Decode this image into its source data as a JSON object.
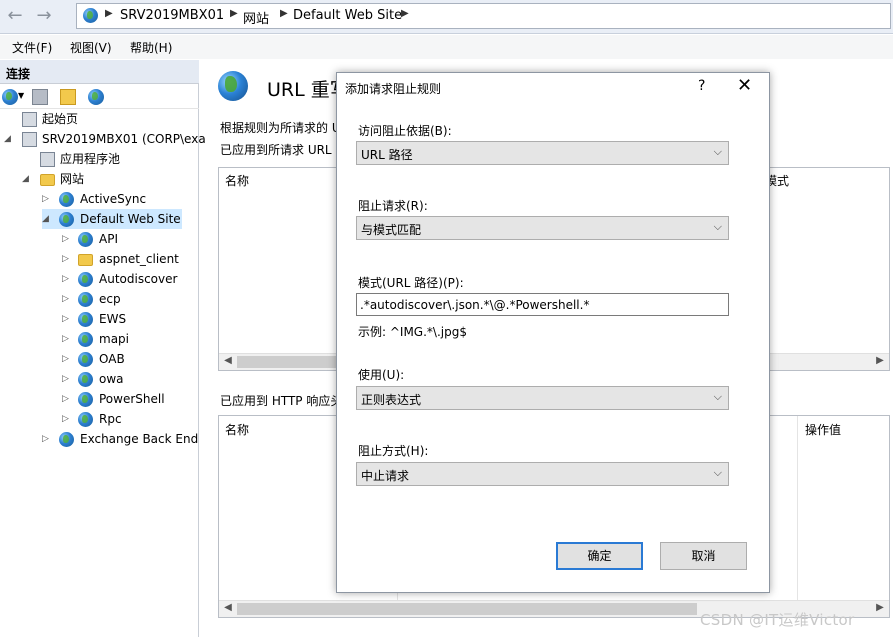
{
  "address_bar": {
    "crumbs": [
      "SRV2019MBX01",
      "网站",
      "Default Web Site"
    ]
  },
  "menu": {
    "items": [
      "文件(F)",
      "视图(V)",
      "帮助(H)"
    ]
  },
  "connections": {
    "title": "连接",
    "toolbar_icons": [
      "connect-icon",
      "save-icon",
      "up-folder-icon",
      "disconnect-icon"
    ],
    "tree": [
      {
        "label": "起始页",
        "icon": "start-page-icon"
      },
      {
        "label": "SRV2019MBX01 (CORP\\exa",
        "icon": "server-icon"
      },
      {
        "label": "应用程序池",
        "icon": "app-pool-icon"
      },
      {
        "label": "网站",
        "icon": "sites-folder-icon"
      },
      {
        "label": "ActiveSync",
        "icon": "globe-icon"
      },
      {
        "label": "Default Web Site",
        "icon": "globe-icon"
      },
      {
        "label": "API",
        "icon": "app-icon"
      },
      {
        "label": "aspnet_client",
        "icon": "folder-icon"
      },
      {
        "label": "Autodiscover",
        "icon": "app-icon"
      },
      {
        "label": "ecp",
        "icon": "app-icon"
      },
      {
        "label": "EWS",
        "icon": "app-icon"
      },
      {
        "label": "mapi",
        "icon": "app-icon"
      },
      {
        "label": "OAB",
        "icon": "app-icon"
      },
      {
        "label": "owa",
        "icon": "app-icon"
      },
      {
        "label": "PowerShell",
        "icon": "app-icon"
      },
      {
        "label": "Rpc",
        "icon": "app-icon"
      },
      {
        "label": "Exchange Back End",
        "icon": "globe-icon"
      }
    ]
  },
  "main": {
    "title": "URL 重写",
    "desc1": "根据规则为所请求的 U",
    "desc2": "已应用到所请求 URL ",
    "grid1": {
      "col_name": "名称",
      "col_pattern": "模式"
    },
    "section2": "已应用到 HTTP 响应头",
    "grid2": {
      "col_name": "名称",
      "col_action_value": "操作值"
    }
  },
  "dialog": {
    "title": "添加请求阻止规则",
    "help": "?",
    "close": "✕",
    "block_basis_label": "访问阻止依据(B):",
    "block_basis_value": "URL 路径",
    "block_request_label": "阻止请求(R):",
    "block_request_value": "与模式匹配",
    "pattern_label": "模式(URL 路径)(P):",
    "pattern_value": ".*autodiscover\\.json.*\\@.*Powershell.*",
    "example": "示例: ^IMG.*\\.jpg$",
    "using_label": "使用(U):",
    "using_value": "正则表达式",
    "how_label": "阻止方式(H):",
    "how_value": "中止请求",
    "ok": "确定",
    "cancel": "取消"
  },
  "watermark": "CSDN @IT运维Victor"
}
